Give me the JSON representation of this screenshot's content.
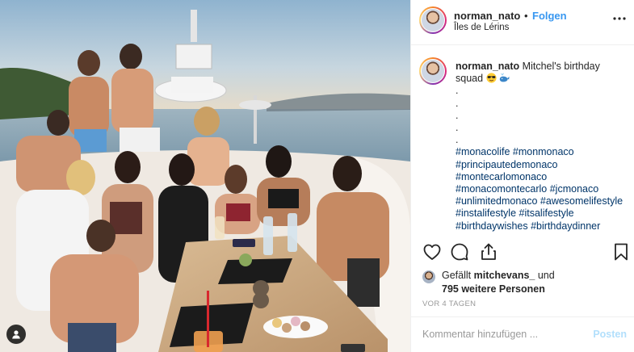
{
  "post": {
    "username": "norman_nato",
    "separator": "•",
    "follow_label": "Folgen",
    "location": "Îles de Lérins",
    "more_icon": "more-horizontal-icon"
  },
  "caption": {
    "username": "norman_nato",
    "text": "Mitchel's birthday squad",
    "emojis": [
      "sunglasses-emoji",
      "whale-emoji"
    ],
    "dots": [
      ".",
      ".",
      ".",
      ".",
      "."
    ],
    "hashtag_lines": [
      "#monacolife #monmonaco",
      "#principautedemonaco",
      "#montecarlomonaco",
      "#monacomontecarlo #jcmonaco",
      "#unlimitedmonaco #awesomelifestyle",
      "#instalifestyle #itsalifestyle",
      "#birthdaywishes #birthdaydinner"
    ]
  },
  "actions": {
    "icons": [
      "heart-icon",
      "comment-icon",
      "share-icon",
      "bookmark-icon"
    ]
  },
  "likes": {
    "prefix": "Gefällt",
    "first_liker": "mitchevans_",
    "connector": "und",
    "others": "795 weitere Personen"
  },
  "timestamp": "VOR 4 TAGEN",
  "comment_box": {
    "placeholder": "Kommentar hinzufügen ...",
    "post_label": "Posten"
  },
  "colors": {
    "follow_blue": "#3897f0",
    "hashtag_blue": "#003569",
    "post_disabled": "#b2dffc",
    "border": "#efefef",
    "secondary_text": "#999999"
  }
}
